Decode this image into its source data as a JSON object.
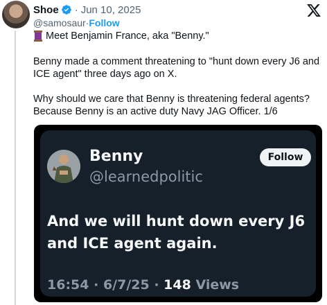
{
  "post": {
    "author_name": "Shoe",
    "separator": "·",
    "date": "Jun 10, 2025",
    "handle": "@samosaur",
    "handle_separator": " · ",
    "follow_label": "Follow",
    "line1": "Meet Benjamin France, aka \"Benny.\"",
    "paragraph2": "Benny made a comment threatening to \"hunt down every J6 and ICE agent\" three days ago on X.",
    "paragraph3": "Why should we care that Benny is threatening federal agents? Because Benny is an active duty Navy JAG Officer. 1/6",
    "icons": {
      "verified": "verified-badge-icon",
      "platform": "x-logo-icon",
      "thread": "thread-spool-icon"
    }
  },
  "embedded_post": {
    "author_name": "Benny",
    "handle": "@learnedpolitic",
    "follow_label": "Follow",
    "text": "And we will hunt down every J6 and ICE agent again.",
    "time": "16:54",
    "separator1": " · ",
    "date": "6/7/25",
    "separator2": " · ",
    "views_count": "148",
    "views_label": " Views"
  },
  "colors": {
    "verified_blue": "#1d9bf0",
    "link_blue": "#1d9bf0",
    "embed_bg": "#15202b"
  }
}
